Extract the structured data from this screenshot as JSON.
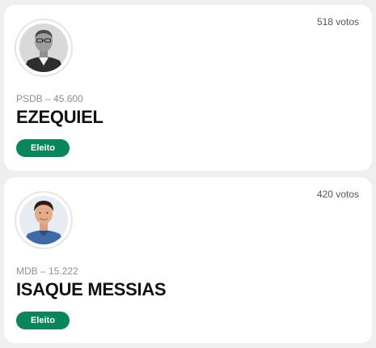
{
  "candidates": [
    {
      "votes": "518 votos",
      "party": "PSDB – 45.600",
      "name": "EZEQUIEL",
      "status": "Eleito",
      "photo": "candidate-photo-grayscale-man-suit"
    },
    {
      "votes": "420 votos",
      "party": "MDB – 15.222",
      "name": "ISAQUE MESSIAS",
      "status": "Eleito",
      "photo": "candidate-photo-young-man-blue-shirt"
    }
  ],
  "colors": {
    "badge": "#07875a",
    "card": "#ffffff",
    "background": "#efefef",
    "party_text": "#8a8f9a"
  }
}
